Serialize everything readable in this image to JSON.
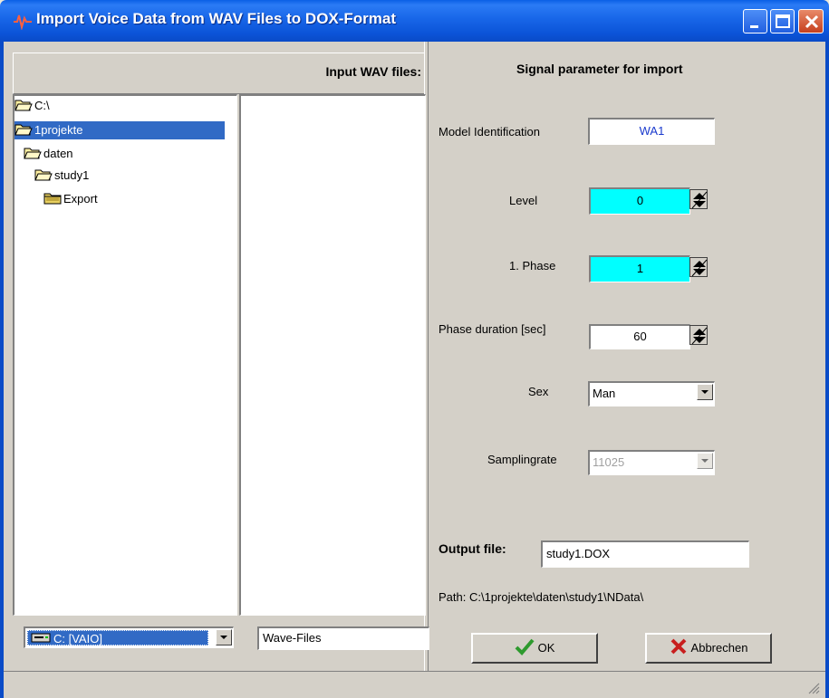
{
  "window": {
    "title": "Import Voice Data from WAV Files to DOX-Format",
    "controls": [
      "minimize-icon",
      "maximize-icon",
      "close-icon"
    ],
    "title_bar_color": "#0a4bc7"
  },
  "left_panel": {
    "header": "Input WAV files:",
    "tree": [
      {
        "label": "C:\\",
        "icon": "folder-open-icon",
        "selected": false
      },
      {
        "label": "1projekte",
        "icon": "folder-open-icon",
        "selected": true
      },
      {
        "label": "daten",
        "icon": "folder-open-icon",
        "selected": false
      },
      {
        "label": "study1",
        "icon": "folder-open-icon",
        "selected": false
      },
      {
        "label": "Export",
        "icon": "folder-closed-icon",
        "selected": false
      }
    ],
    "drive": "C: [VAIO]",
    "filter": "Wave-Files"
  },
  "signal": {
    "title": "Signal parameter for import",
    "model_id_label": "Model Identification",
    "model_id_value": "WA1",
    "level_label": "Level",
    "level_value": "0",
    "phase_label": "1. Phase",
    "phase_value": "1",
    "duration_label": "Phase duration [sec]",
    "duration_value": "60",
    "sex_label": "Sex",
    "sex_value": "Man",
    "samplingrate_label": "Samplingrate",
    "samplingrate_value": "11025",
    "output_label": "Output file:",
    "output_value": "study1.DOX",
    "path_text": "Path: C:\\1projekte\\daten\\study1\\NData\\"
  },
  "buttons": {
    "ok": "OK",
    "cancel": "Abbrechen"
  },
  "colors": {
    "highlight": "#316ac5",
    "cyan_field": "#00ffff",
    "ok_check": "#2e9a2e",
    "cancel_x": "#c81e1e"
  }
}
